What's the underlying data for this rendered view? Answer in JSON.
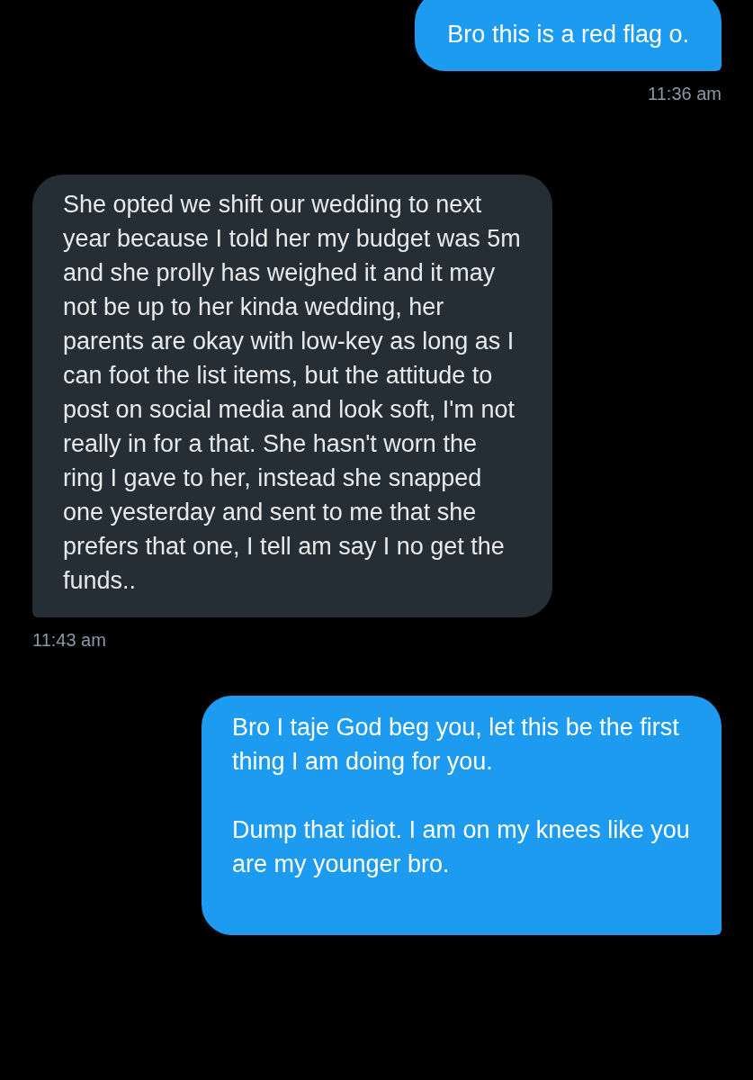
{
  "messages": [
    {
      "kind": "sent",
      "paragraphs": [
        "Bro this is a red flag o."
      ],
      "time": "11:36 am"
    },
    {
      "kind": "received",
      "paragraphs": [
        "She opted we shift our wedding to next year because I told her my budget was 5m and she prolly has weighed it and it may not be up to her kinda wedding, her parents are okay with low-key as long as I can foot the list items, but the attitude to post on social media and look soft, I'm not really in for a that. She hasn't worn the ring I gave to her, instead she snapped one yesterday and sent to me that she prefers that one, I tell am say I no get the funds.."
      ],
      "time": "11:43 am"
    },
    {
      "kind": "sent",
      "paragraphs": [
        "Bro I taje God beg you, let this be the first thing I am doing for you.",
        "Dump that idiot. I am on my knees like you are my younger bro."
      ]
    }
  ]
}
